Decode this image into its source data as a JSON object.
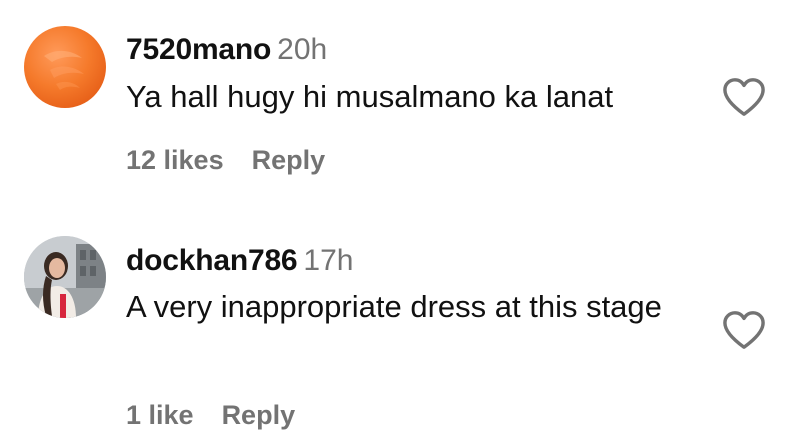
{
  "comments": [
    {
      "username": "7520mano",
      "time": "20h",
      "text": "Ya hall hugy hi musalmano ka lanat",
      "likes": "12 likes",
      "reply": "Reply",
      "avatar_icon": "orange-avatar",
      "like_icon": "heart-outline-icon"
    },
    {
      "username": "dockhan786",
      "time": "17h",
      "text": "A very inappropriate dress at this stage",
      "likes": "1 like",
      "reply": "Reply",
      "avatar_icon": "profile-photo-avatar",
      "like_icon": "heart-outline-icon"
    }
  ],
  "colors": {
    "text_primary": "#111111",
    "text_secondary": "#737373",
    "avatar_orange": "#f57a2b",
    "background": "#ffffff"
  }
}
